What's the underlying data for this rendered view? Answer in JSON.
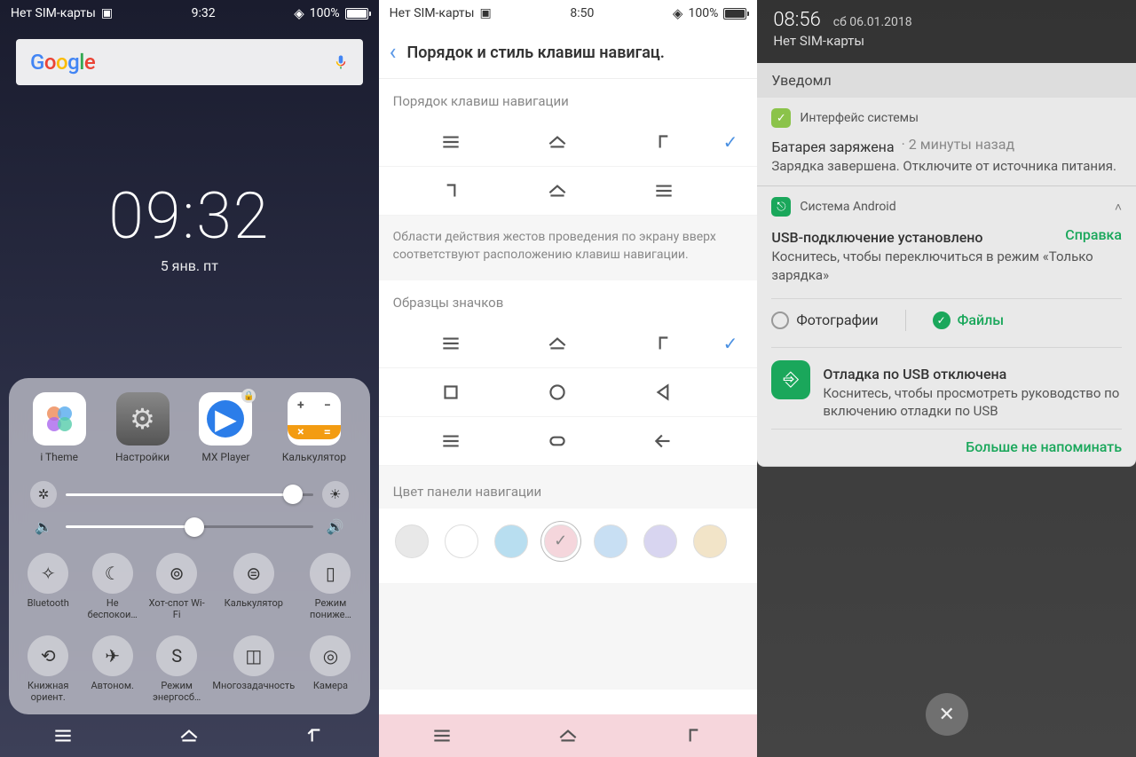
{
  "phone1": {
    "status": {
      "sim": "Нет SIM-карты",
      "time": "9:32",
      "battery": "100%"
    },
    "search_placeholder": "Google",
    "clock": {
      "time": "09:32",
      "date": "5 янв.  пт"
    },
    "apps": [
      {
        "label": "i Theme"
      },
      {
        "label": "Настройки"
      },
      {
        "label": "MX Player"
      },
      {
        "label": "Калькулятор"
      }
    ],
    "quick_toggles": [
      "Bluetooth",
      "Не беспокои…",
      "Хот-спот Wi-Fi",
      "Калькулятор",
      "Режим пониже…",
      "Книжная ориент.",
      "Автоном.",
      "Режим энергосб…",
      "Многозадачность",
      "Камера"
    ]
  },
  "phone2": {
    "status": {
      "sim": "Нет SIM-карты",
      "time": "8:50",
      "battery": "100%"
    },
    "title": "Порядок и стиль клавиш навигац.",
    "section1": "Порядок клавиш навигации",
    "gesture_desc": "Области действия жестов проведения по экрану вверх соответствуют расположению клавиш навигации.",
    "section2": "Образцы значков",
    "section3": "Цвет панели навигации",
    "colors": [
      "#e8e8e8",
      "#ffffff",
      "#b8def0",
      "#f5d6dc",
      "#c8dff3",
      "#d8d5f0",
      "#f2e4c8"
    ],
    "selected_color_index": 3
  },
  "phone3": {
    "clock": "08:56",
    "date": "сб 06.01.2018",
    "sim": "Нет SIM-карты",
    "header": "Уведомл",
    "n1": {
      "app": "Интерфейс системы",
      "title": "Батарея заряжена",
      "meta": "2 минуты назад",
      "body": "Зарядка завершена. Отключите от источника питания."
    },
    "n2": {
      "app": "Система Android",
      "title": "USB-подключение установлено",
      "help": "Справка",
      "body": "Коснитесь, чтобы переключиться в режим «Только зарядка»",
      "opt1": "Фотографии",
      "opt2": "Файлы",
      "sub_title": "Отладка по USB отключена",
      "sub_body": "Коснитесь, чтобы просмотреть руководство по включению отладки по USB",
      "action": "Больше не напоминать"
    }
  }
}
